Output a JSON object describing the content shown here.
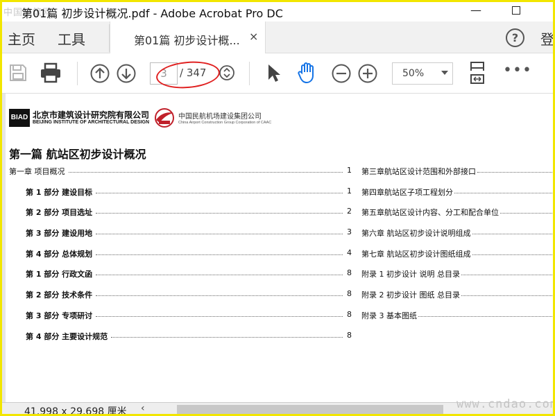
{
  "window": {
    "title": "第01篇 初步设计概况.pdf - Adobe Acrobat Pro DC",
    "minimize": "—",
    "watermark_top_left": "中国建筑网",
    "watermark_bottom_right": "www.cndao.com"
  },
  "menubar": {
    "home": "主页",
    "tools": "工具",
    "doc_tab_label": "第01篇 初步设计概...",
    "tab_close": "×",
    "help": "?",
    "login": "登"
  },
  "toolbar": {
    "page_current": "3",
    "page_total": "/ 347",
    "zoom": "50%",
    "more": "•••"
  },
  "document": {
    "org1_abbr": "BIAD",
    "org1_cn": "北京市建筑设计研究院有限公司",
    "org1_en": "BEIJING INSTITUTE OF ARCHITECTURAL DESIGN",
    "org2_cn": "中国民航机场建设集团公司",
    "org2_en": "China Airport Construction Group Corporation of CAAC",
    "heading": "第一篇 航站区初步设计概况",
    "toc_left": [
      {
        "label": "第一章  项目概况",
        "page": "1",
        "indent": false
      },
      {
        "label": "第 1 部分    建设目标",
        "page": "1",
        "indent": true
      },
      {
        "label": "第 2 部分    项目选址",
        "page": "2",
        "indent": true
      },
      {
        "label": "第 3 部分    建设用地",
        "page": "3",
        "indent": true
      },
      {
        "label": "第 4 部分    总体规划",
        "page": "4",
        "indent": true
      },
      {
        "label": "第 1 部分    行政文函",
        "page": "8",
        "indent": true
      },
      {
        "label": "第 2 部分    技术条件",
        "page": "8",
        "indent": true
      },
      {
        "label": "第 3 部分    专项研讨",
        "page": "8",
        "indent": true
      },
      {
        "label": "第 4 部分    主要设计规范",
        "page": "8",
        "indent": true
      }
    ],
    "toc_right": [
      {
        "label": "第三章航站区设计范围和外部接口"
      },
      {
        "label": "第四章航站区子项工程划分"
      },
      {
        "label": "第五章航站区设计内容、分工和配合单位"
      },
      {
        "label": "第六章  航站区初步设计说明组成"
      },
      {
        "label": "第七章  航站区初步设计图纸组成"
      },
      {
        "label": "附录 1  初步设计  说明  总目录"
      },
      {
        "label": "附录 2  初步设计  图纸  总目录"
      },
      {
        "label": "附录 3  基本图纸"
      }
    ]
  },
  "statusbar": {
    "dimensions": "41.998 x 29.698 厘米",
    "scroll_left": "‹"
  },
  "colors": {
    "window_border": "#f2e600",
    "annotation_ellipse": "#e02020",
    "hand_tool": "#1473e6"
  }
}
